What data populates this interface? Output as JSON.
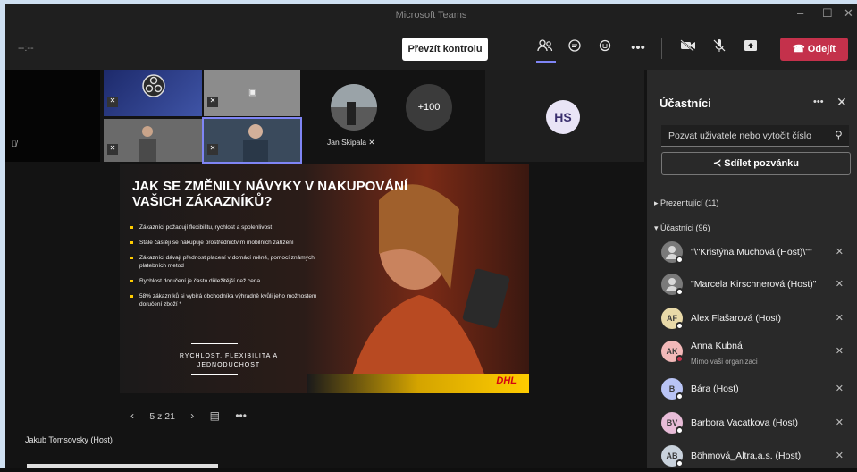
{
  "window": {
    "title": "Microsoft Teams",
    "controls": [
      "–",
      "☐",
      "✕"
    ]
  },
  "toolbar": {
    "timer": "--:--",
    "take_control": "Převzít kontrolu",
    "leave": "Odejít",
    "icons": [
      "people-icon",
      "chat-icon",
      "react-icon",
      "more-icon",
      "camera-off-icon",
      "mic-off-icon",
      "share-icon"
    ]
  },
  "video": {
    "tiles": [
      {
        "label": ""
      },
      {
        "label": ""
      },
      {
        "label": ""
      },
      {
        "label": ""
      },
      {
        "label": ""
      }
    ],
    "jan_name": "Jan Skipala",
    "overflow": "+100",
    "hs_initials": "HS"
  },
  "slide": {
    "heading": "JAK SE ZMĚNILY NÁVYKY V NAKUPOVÁNÍ VAŠICH ZÁKAZNÍKŮ?",
    "bullets": [
      "Zákazníci požadují flexibilitu, rychlost a spolehlivost",
      "Stále častěji se nakupuje prostřednictvím mobilních zařízení",
      "Zákazníci dávají přednost placení v domácí měně, pomocí známých platebních metod",
      "Rychlost doručení je často důležitější než cena",
      "58% zákazníků si vybírá obchodníka výhradně kvůli jeho možnostem doručení zboží *"
    ],
    "tagline": "RYCHLOST, FLEXIBILITA A JEDNODUCHOST",
    "brand": "DHL"
  },
  "pager": {
    "text": "5 z 21"
  },
  "presenter": "Jakub Tomsovsky (Host)",
  "panel": {
    "title": "Účastníci",
    "invite_placeholder": "Pozvat uživatele nebo vytočit číslo",
    "share": "Sdílet pozvánku",
    "presenters_section": "Prezentující (11)",
    "attendees_section": "Účastníci (96)",
    "people": [
      {
        "initials": "",
        "name": "\"\\\"Kristýna Muchová (Host)\\\"\"",
        "sub": "",
        "color": "#7a7a7a",
        "status": "#ffffff"
      },
      {
        "initials": "",
        "name": "\"Marcela Kirschnerová (Host)\"",
        "sub": "",
        "color": "#7a7a7a",
        "status": "#ffffff"
      },
      {
        "initials": "AF",
        "name": "Alex Flašarová (Host)",
        "sub": "",
        "color": "#e8d9a8",
        "status": "#ffffff"
      },
      {
        "initials": "AK",
        "name": "Anna Kubná",
        "sub": "Mimo vaši organizaci",
        "color": "#f2b8b8",
        "status": "#c4314b"
      },
      {
        "initials": "B",
        "name": "Bára (Host)",
        "sub": "",
        "color": "#b9c4f5",
        "status": "#ffffff"
      },
      {
        "initials": "BV",
        "name": "Barbora Vacatkova (Host)",
        "sub": "",
        "color": "#e8bcd8",
        "status": "#ffffff"
      },
      {
        "initials": "AB",
        "name": "Böhmová_Altra,a.s. (Host)",
        "sub": "",
        "color": "#c9d2dc",
        "status": "#ffffff"
      }
    ]
  }
}
